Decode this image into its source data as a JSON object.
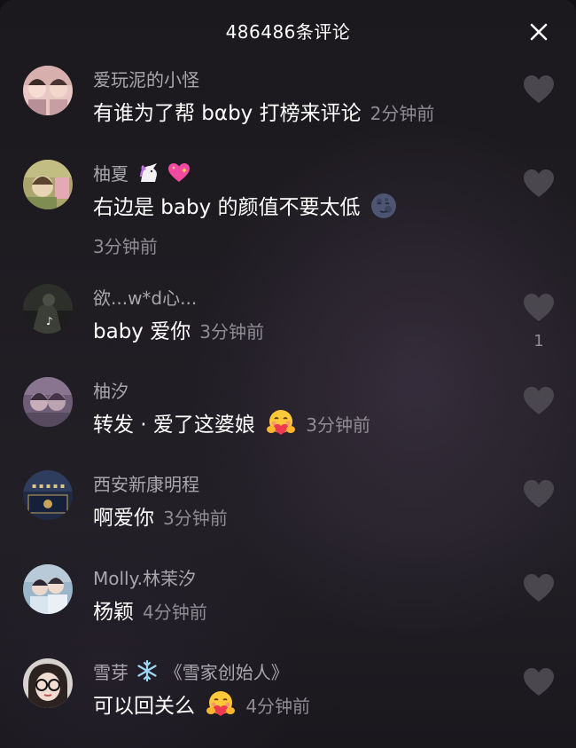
{
  "header": {
    "title": "486486条评论",
    "close_icon": "close-icon"
  },
  "colors": {
    "background": "#1e1b21",
    "username": "#a9a7ac",
    "text": "#ffffff",
    "time": "#8f8c93",
    "like_icon": "#4a474e"
  },
  "comments": [
    {
      "username": "爱玩泥的小怪",
      "text": "有谁为了帮 bαby 打榜来评论",
      "time": "2分钟前",
      "like_count": ""
    },
    {
      "username": "柚夏",
      "username_emojis": [
        "unicorn-emoji",
        "sparkling-heart-emoji"
      ],
      "text": "右边是 baby 的颜值不要太低",
      "text_emoji": "new-moon-face-emoji",
      "time": "3分钟前",
      "like_count": ""
    },
    {
      "username": "欲...w*d心...",
      "text": "baby 爱你",
      "time": "3分钟前",
      "like_count": "1"
    },
    {
      "username": "柚汐",
      "text": "转发 · 爱了这婆娘",
      "text_emoji": "hugging-face-emoji",
      "time": "3分钟前",
      "like_count": ""
    },
    {
      "username": "西安新康明程",
      "text": "啊爱你",
      "time": "3分钟前",
      "like_count": ""
    },
    {
      "username": "Molly.林茉汐",
      "text": "杨颖",
      "time": "4分钟前",
      "like_count": ""
    },
    {
      "username": "雪芽",
      "username_suffix": "《雪家创始人》",
      "username_emoji": "snowflake-emoji",
      "text": "可以回关么",
      "text_emoji": "hugging-face-emoji",
      "time": "4分钟前",
      "like_count": ""
    }
  ]
}
